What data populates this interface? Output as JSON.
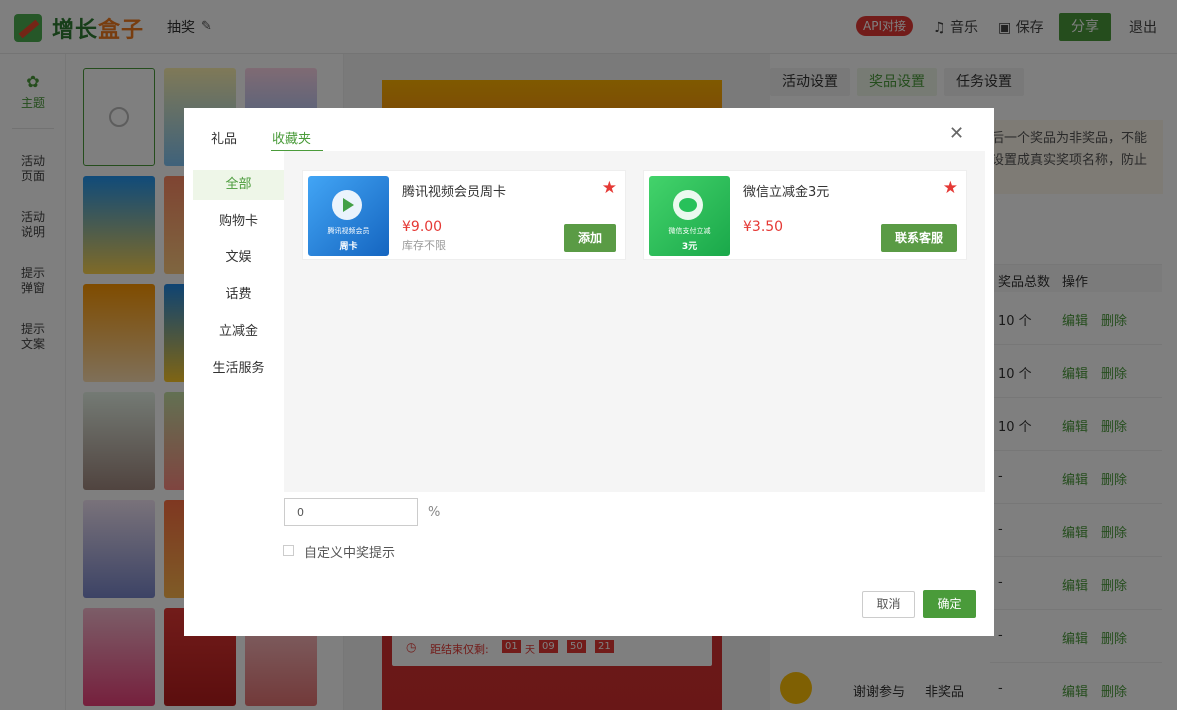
{
  "topbar": {
    "logo_main": "增长",
    "logo_accent": "盒子",
    "logo_tail": "子",
    "project": "抽奖",
    "api_badge": "API对接",
    "music": "音乐",
    "save": "保存",
    "share": "分享",
    "logout": "退出"
  },
  "leftnav": {
    "items": [
      {
        "label": "主题"
      },
      {
        "label": "活动\n页面"
      },
      {
        "label": "活动\n说明"
      },
      {
        "label": "提示\n弹窗"
      },
      {
        "label": "提示\n文案"
      }
    ]
  },
  "right_panel": {
    "tabs": [
      "活动设置",
      "奖品设置",
      "任务设置"
    ],
    "tip": "后一个奖品为非奖品，不能\n设置成真实奖项名称，防止",
    "col_total": "奖品总数",
    "col_action": "操作",
    "rows": [
      {
        "total": "10 个"
      },
      {
        "total": "10 个"
      },
      {
        "total": "10 个"
      },
      {
        "total": "-"
      },
      {
        "total": "-"
      },
      {
        "total": "-"
      },
      {
        "total": "-"
      },
      {
        "total": "-"
      }
    ],
    "edit": "编辑",
    "delete": "删除",
    "bottom_name": "谢谢参与",
    "bottom_type": "非奖品"
  },
  "countdown": {
    "label": "距结束仅剩:",
    "days": "01",
    "day_unit": "天",
    "h": "09",
    "m": "50",
    "s": "21"
  },
  "modal": {
    "tabs": [
      "礼品",
      "收藏夹"
    ],
    "active_tab": 1,
    "categories": [
      "全部",
      "购物卡",
      "文娱",
      "话费",
      "立减金",
      "生活服务"
    ],
    "active_category": 0,
    "cards": [
      {
        "name": "腾讯视频会员周卡",
        "price": "¥9.00",
        "stock": "库存不限",
        "button": "添加",
        "img_caption": "腾讯视频会员",
        "img_sub": "周卡",
        "color": "#1e88e5"
      },
      {
        "name": "微信立减金3元",
        "price": "¥3.50",
        "stock": "",
        "button": "联系客服",
        "img_caption": "微信支付立减",
        "img_sub": "3元",
        "color": "#27c15a"
      }
    ]
  },
  "form": {
    "percent_value": "0",
    "percent_unit": "%",
    "custom_tip_label": "自定义中奖提示",
    "cancel": "取消",
    "confirm": "确定"
  }
}
